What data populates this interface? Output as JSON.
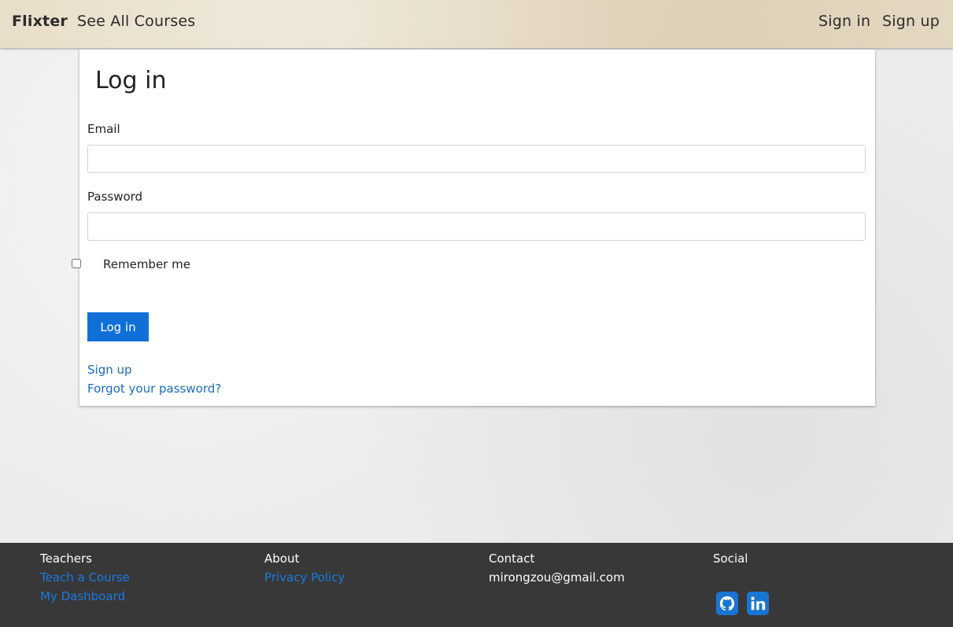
{
  "nav": {
    "brand": "Flixter",
    "see_all": "See All Courses",
    "sign_in": "Sign in",
    "sign_up": "Sign up"
  },
  "form": {
    "title": "Log in",
    "email_label": "Email",
    "email_value": "",
    "password_label": "Password",
    "password_value": "",
    "remember_label": "Remember me",
    "submit_label": "Log in",
    "signup_link": "Sign up",
    "forgot_link": "Forgot your password?"
  },
  "footer": {
    "teachers": {
      "heading": "Teachers",
      "links": [
        "Teach a Course",
        "My Dashboard"
      ]
    },
    "about": {
      "heading": "About",
      "links": [
        "Privacy Policy"
      ]
    },
    "contact": {
      "heading": "Contact",
      "email": "mirongzou@gmail.com"
    },
    "social": {
      "heading": "Social",
      "icons": [
        "github-icon",
        "linkedin-icon"
      ]
    }
  },
  "colors": {
    "accent": "#1170d8",
    "link": "#1a6bbf",
    "footer_bg": "#383838",
    "social_icon": "#1976d2"
  }
}
